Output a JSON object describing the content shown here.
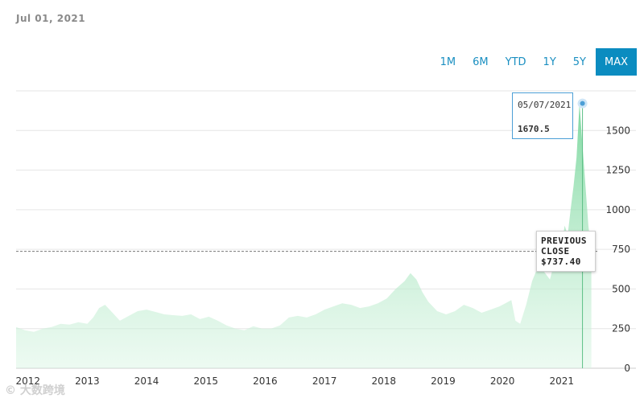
{
  "header": {
    "date": "Jul 01, 2021"
  },
  "range_buttons": [
    {
      "label": "1M",
      "active": false
    },
    {
      "label": "6M",
      "active": false
    },
    {
      "label": "YTD",
      "active": false
    },
    {
      "label": "1Y",
      "active": false
    },
    {
      "label": "5Y",
      "active": false
    },
    {
      "label": "MAX",
      "active": true
    }
  ],
  "tooltip": {
    "date": "05/07/2021",
    "value": "1670.5"
  },
  "previous_close": {
    "line1": "PREVIOUS",
    "line2": "CLOSE",
    "value": "$737.40"
  },
  "watermark": "© 大数跨境",
  "colors": {
    "area": "#7fd9a2",
    "accent": "#0b8cc0",
    "hover_line": "#5cbf86"
  },
  "chart_data": {
    "type": "area",
    "title": "",
    "xlabel": "",
    "ylabel": "",
    "x_ticks": [
      "2012",
      "2013",
      "2014",
      "2015",
      "2016",
      "2017",
      "2018",
      "2019",
      "2020",
      "2021"
    ],
    "y_ticks": [
      0,
      250,
      500,
      750,
      1000,
      1250,
      1500
    ],
    "xlim": [
      2011.8,
      2021.6
    ],
    "ylim": [
      0,
      1750
    ],
    "previous_close": 737.4,
    "hover_point": {
      "date": "2021-05-07",
      "value": 1670.5
    },
    "grid": true,
    "series": [
      {
        "x": [
          2011.8,
          2011.95,
          2012.1,
          2012.25,
          2012.4,
          2012.55,
          2012.7,
          2012.85,
          2013.0,
          2013.1,
          2013.2,
          2013.3,
          2013.4,
          2013.55,
          2013.7,
          2013.85,
          2014.0,
          2014.15,
          2014.3,
          2014.45,
          2014.6,
          2014.75,
          2014.9,
          2015.05,
          2015.2,
          2015.35,
          2015.5,
          2015.65,
          2015.8,
          2015.95,
          2016.1,
          2016.25,
          2016.4,
          2016.55,
          2016.7,
          2016.85,
          2017.0,
          2017.15,
          2017.3,
          2017.45,
          2017.6,
          2017.75,
          2017.9,
          2018.05,
          2018.2,
          2018.35,
          2018.45,
          2018.55,
          2018.65,
          2018.75,
          2018.9,
          2019.05,
          2019.2,
          2019.35,
          2019.5,
          2019.65,
          2019.8,
          2019.95,
          2020.05,
          2020.15,
          2020.22,
          2020.3,
          2020.4,
          2020.5,
          2020.6,
          2020.7,
          2020.8,
          2020.9,
          2021.0,
          2021.05,
          2021.1,
          2021.15,
          2021.2,
          2021.25,
          2021.3,
          2021.35,
          2021.4,
          2021.45,
          2021.5
        ],
        "values": [
          260,
          240,
          230,
          250,
          260,
          280,
          275,
          290,
          280,
          320,
          380,
          400,
          360,
          300,
          330,
          360,
          370,
          355,
          340,
          335,
          330,
          340,
          310,
          325,
          300,
          270,
          250,
          240,
          265,
          250,
          250,
          270,
          320,
          330,
          320,
          340,
          370,
          390,
          410,
          400,
          380,
          390,
          410,
          440,
          500,
          550,
          600,
          560,
          480,
          420,
          360,
          340,
          360,
          400,
          380,
          350,
          370,
          390,
          410,
          430,
          300,
          280,
          400,
          550,
          640,
          610,
          560,
          700,
          780,
          900,
          840,
          1000,
          1150,
          1330,
          1670.5,
          1400,
          1150,
          900,
          737.4
        ]
      }
    ]
  }
}
